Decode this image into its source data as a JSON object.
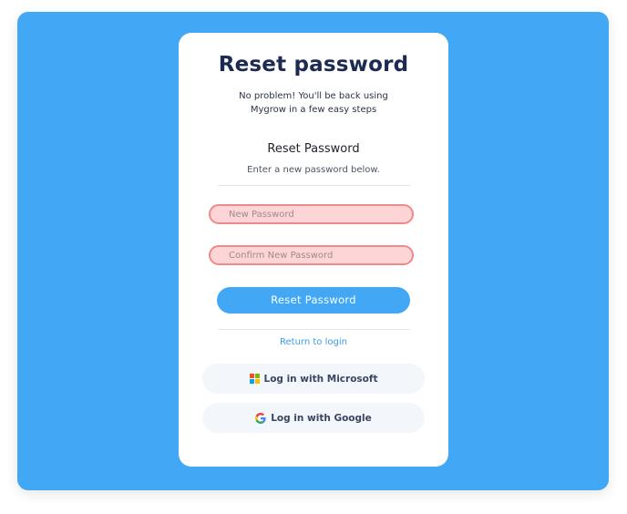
{
  "card": {
    "title": "Reset password",
    "subtitle_line1": "No problem! You'll be back using",
    "subtitle_line2": "Mygrow in a few easy steps"
  },
  "form": {
    "section_title": "Reset Password",
    "section_desc": "Enter a new password below.",
    "new_password_placeholder": "New Password",
    "confirm_password_placeholder": "Confirm New Password",
    "submit_label": "Reset Password",
    "return_link": "Return to login"
  },
  "sso": {
    "microsoft_label": "Log in with Microsoft",
    "google_label": "Log in with Google",
    "microsoft_icon": "microsoft-logo",
    "google_icon": "google-logo"
  },
  "colors": {
    "background": "#42a8f5",
    "card": "#ffffff",
    "title": "#1d2a52",
    "button": "#42a8f5",
    "field_error_fill": "#fdd5d6",
    "field_error_border": "#ee8a8a",
    "link": "#3c9be4",
    "sso_button": "#f3f7fc"
  }
}
